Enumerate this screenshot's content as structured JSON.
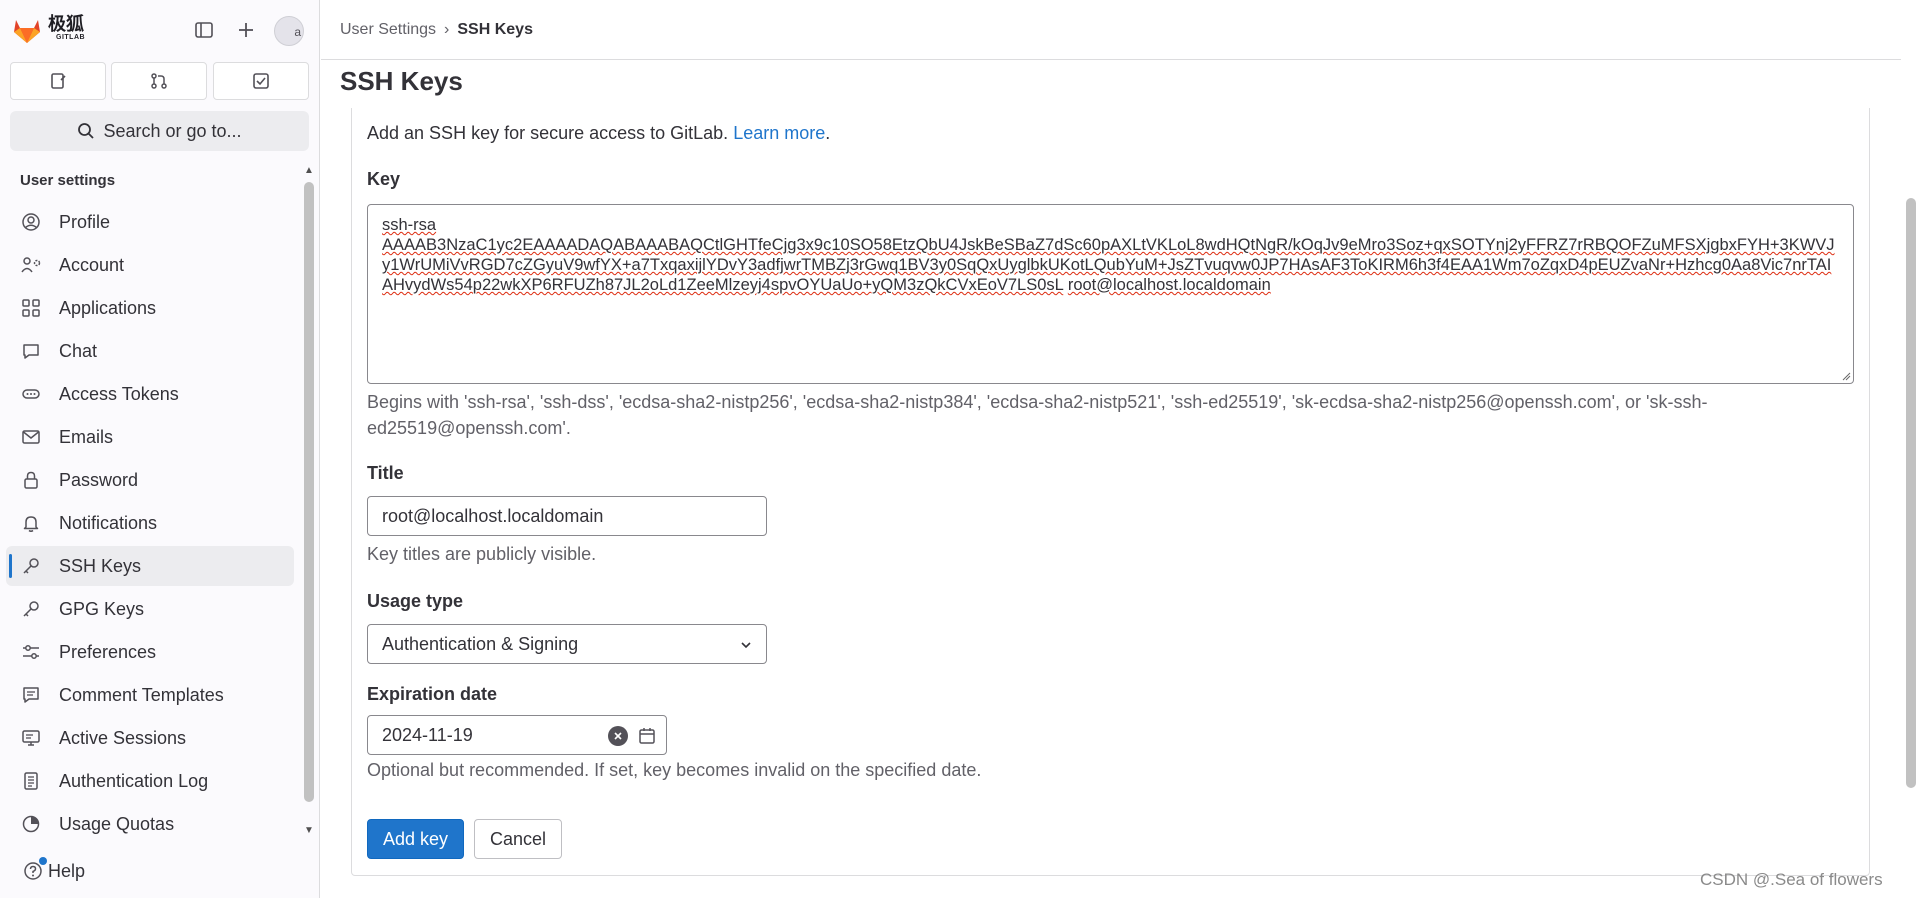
{
  "brand": {
    "name": "极狐",
    "sub": "GITLAB"
  },
  "avatar_alt": "a",
  "search": {
    "label": "Search or go to..."
  },
  "sidebar": {
    "heading": "User settings",
    "items": [
      {
        "label": "Profile",
        "icon": "profile-icon"
      },
      {
        "label": "Account",
        "icon": "account-icon"
      },
      {
        "label": "Applications",
        "icon": "applications-icon"
      },
      {
        "label": "Chat",
        "icon": "chat-icon"
      },
      {
        "label": "Access Tokens",
        "icon": "token-icon"
      },
      {
        "label": "Emails",
        "icon": "mail-icon"
      },
      {
        "label": "Password",
        "icon": "lock-icon"
      },
      {
        "label": "Notifications",
        "icon": "bell-icon"
      },
      {
        "label": "SSH Keys",
        "icon": "key-icon",
        "active": true
      },
      {
        "label": "GPG Keys",
        "icon": "key-icon"
      },
      {
        "label": "Preferences",
        "icon": "preferences-icon"
      },
      {
        "label": "Comment Templates",
        "icon": "comment-icon"
      },
      {
        "label": "Active Sessions",
        "icon": "monitor-icon"
      },
      {
        "label": "Authentication Log",
        "icon": "log-icon"
      },
      {
        "label": "Usage Quotas",
        "icon": "quota-icon"
      }
    ],
    "help_label": "Help"
  },
  "breadcrumb": {
    "parent": "User Settings",
    "separator": "›",
    "current": "SSH Keys"
  },
  "page_title": "SSH Keys",
  "form": {
    "intro_text": "Add an SSH key for secure access to GitLab. ",
    "intro_link": "Learn more",
    "intro_end": ".",
    "key_label": "Key",
    "key_value": {
      "type": "ssh-rsa",
      "body": "AAAAB3NzaC1yc2EAAAADAQABAAABAQCtlGHTfeCjg3x9c10SO58EtzQbU4JskBeSBaZ7dSc60pAXLtVKLoL8wdHQtNgR/kOqJv9eMro3Soz+qxSOTYnj2yFFRZ7rRBQOFZuMFSXjgbxFYH+3KWVJy1WrUMiVvRGD7cZGyuV9wfYX+a7TxqaxijlYDvY3adfjwrTMBZj3rGwq1BV3y0SqQxUyglbkUKotLQubYuM+JsZTvuqvw0JP7HAsAF3ToKIRM6h3f4EAA1Wm7oZqxD4pEUZvaNr+Hzhcg0Aa8Vic7nrTAIAHvydWs54p22wkXP6RFUZh87JL2oLd1ZeeMlzeyj4spvOYUaUo+yQM3zQkCVxEoV7LS0sL",
      "comment": "root@localhost.localdomain"
    },
    "key_help": "Begins with 'ssh-rsa', 'ssh-dss', 'ecdsa-sha2-nistp256', 'ecdsa-sha2-nistp384', 'ecdsa-sha2-nistp521', 'ssh-ed25519', 'sk-ecdsa-sha2-nistp256@openssh.com', or 'sk-ssh-ed25519@openssh.com'.",
    "title_label": "Title",
    "title_value": "root@localhost.localdomain",
    "title_help": "Key titles are publicly visible.",
    "usage_label": "Usage type",
    "usage_value": "Authentication & Signing",
    "expiration_label": "Expiration date",
    "expiration_value": "2024-11-19",
    "expiration_help": "Optional but recommended. If set, key becomes invalid on the specified date.",
    "add_button": "Add key",
    "cancel_button": "Cancel"
  },
  "watermark": "CSDN @.Sea of flowers",
  "colors": {
    "accent": "#1f75cb",
    "text": "#333238",
    "muted": "#626168",
    "border": "#dcdcde",
    "brand": "#fc6d26"
  }
}
